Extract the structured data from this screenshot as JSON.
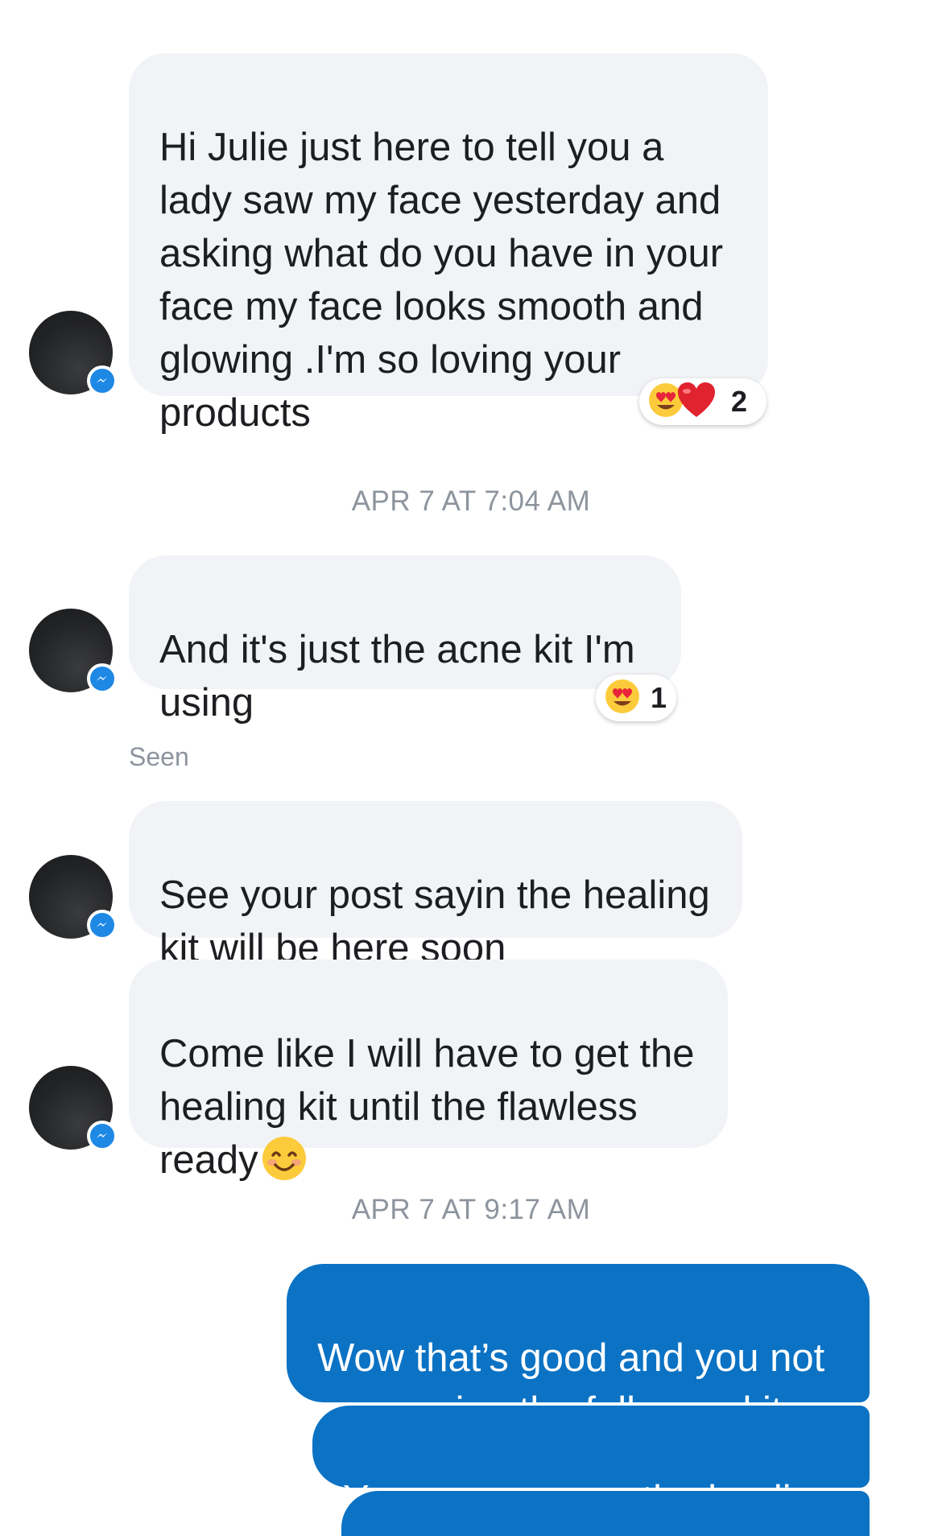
{
  "conversation": {
    "messages_in": [
      {
        "text": "Hi Julie just here to tell you a\nlady saw my face yesterday and\nasking what do  you have in your\nface my face looks smooth and\nglowing .I'm so loving your\nproducts",
        "reaction_count": "2",
        "reactions": [
          "heart-eyes-emoji",
          "red-heart-emoji"
        ]
      },
      {
        "text": "And it's just the acne kit I'm\nusing",
        "reaction_count": "1",
        "reactions": [
          "heart-eyes-emoji"
        ]
      },
      {
        "text": "See your post sayin the healing\nkit will be here soon"
      },
      {
        "text": "Come like I will have to get the\nhealing  kit until the flawless\nready",
        "trailing_emoji": "smiling-face-emoji"
      }
    ],
    "timestamps": [
      "APR 7 AT 7:04 AM",
      "APR 7 AT 9:17 AM"
    ],
    "seen_label": "Seen",
    "messages_out": [
      {
        "text": "Wow that’s good and you not\neven using the full acne kit"
      },
      {
        "text": "Yes you can use the healing"
      }
    ]
  },
  "colors": {
    "incoming_bubble": "#f1f3f6",
    "outgoing_bubble": "#0b72c4",
    "messenger_badge": "#1e88e5",
    "timestamp_text": "#8d949e"
  }
}
